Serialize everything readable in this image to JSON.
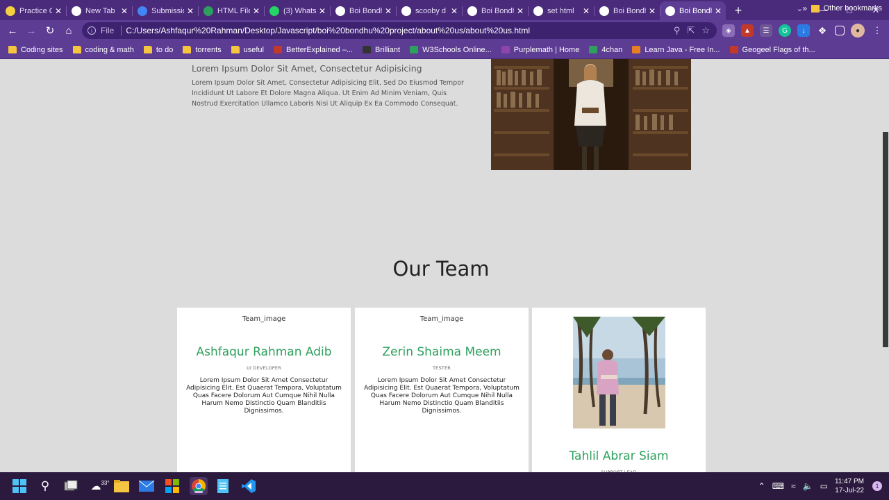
{
  "browser": {
    "tabs": [
      {
        "title": "Practice C",
        "favicon": "practice-favicon",
        "color": "#f5d142"
      },
      {
        "title": "New Tab",
        "favicon": "chrome-favicon",
        "color": "#ffffff"
      },
      {
        "title": "Submissio",
        "favicon": "chart-favicon",
        "color": "#4285f4"
      },
      {
        "title": "HTML File",
        "favicon": "w-favicon",
        "color": "#2ea05e"
      },
      {
        "title": "(3) Whats",
        "favicon": "whatsapp-favicon",
        "color": "#25d366"
      },
      {
        "title": "Boi Bondh",
        "favicon": "globe-favicon",
        "color": "#ffffff"
      },
      {
        "title": "scooby d",
        "favicon": "google-favicon",
        "color": "#ffffff"
      },
      {
        "title": "Boi Bondh",
        "favicon": "globe-favicon",
        "color": "#ffffff"
      },
      {
        "title": "set html",
        "favicon": "google-favicon",
        "color": "#ffffff"
      },
      {
        "title": "Boi Bondh",
        "favicon": "globe-favicon",
        "color": "#ffffff"
      },
      {
        "title": "Boi Bondh",
        "favicon": "globe-favicon",
        "color": "#ffffff",
        "active": true
      }
    ],
    "new_tab_symbol": "+",
    "address": {
      "scheme": "File",
      "url": "C:/Users/Ashfaqur%20Rahman/Desktop/Javascript/boi%20bondhu%20project/about%20us/about%20us.html"
    },
    "bookmarks": [
      {
        "label": "Coding sites",
        "icon": "folder-icon"
      },
      {
        "label": "coding & math",
        "icon": "folder-icon"
      },
      {
        "label": "to do",
        "icon": "folder-icon"
      },
      {
        "label": "torrents",
        "icon": "folder-icon"
      },
      {
        "label": "useful",
        "icon": "folder-icon"
      },
      {
        "label": "BetterExplained –...",
        "icon": "be-icon",
        "color": "#c0392b"
      },
      {
        "label": "Brilliant",
        "icon": "brilliant-icon",
        "color": "#333333"
      },
      {
        "label": "W3Schools Online...",
        "icon": "w3-icon",
        "color": "#2ea05e"
      },
      {
        "label": "Purplemath | Home",
        "icon": "purplemath-icon",
        "color": "#8e44ad"
      },
      {
        "label": "4chan",
        "icon": "4chan-icon",
        "color": "#2ea05e"
      },
      {
        "label": "Learn Java - Free In...",
        "icon": "java-icon",
        "color": "#e67e22"
      },
      {
        "label": "Geogeel Flags of th...",
        "icon": "geo-icon",
        "color": "#c0392b"
      }
    ],
    "bookmarks_more": "»",
    "other_bookmarks": "Other bookmarks"
  },
  "page": {
    "about_heading": "Lorem Ipsum Dolor Sit Amet, Consectetur Adipisicing",
    "about_text": "Lorem Ipsum Dolor Sit Amet, Consectetur Adipisicing Elit, Sed Do Eiusmod Tempor Incididunt Ut Labore Et Dolore Magna Aliqua. Ut Enim Ad Minim Veniam, Quis Nostrud Exercitation Ullamco Laboris Nisi Ut Aliquip Ex Ea Commodo Consequat.",
    "team_title": "Our Team",
    "team": [
      {
        "image_alt": "Team_image",
        "name": "Ashfaqur Rahman Adib",
        "role": "UI DEVELOPER",
        "desc": "Lorem Ipsum Dolor Sit Amet Consectetur Adipisicing Elit. Est Quaerat Tempora, Voluptatum Quas Facere Dolorum Aut Cumque Nihil Nulla Harum Nemo Distinctio Quam Blanditiis Dignissimos."
      },
      {
        "image_alt": "Team_image",
        "name": "Zerin Shaima Meem",
        "role": "TESTER",
        "desc": "Lorem Ipsum Dolor Sit Amet Consectetur Adipisicing Elit. Est Quaerat Tempora, Voluptatum Quas Facere Dolorum Aut Cumque Nihil Nulla Harum Nemo Distinctio Quam Blanditiis Dignissimos."
      },
      {
        "name": "Tahlil Abrar Siam",
        "role": "SUPPORT LEAD"
      }
    ],
    "accent_color": "#2ea05e"
  },
  "taskbar": {
    "weather_temp": "33°",
    "time": "11:47 PM",
    "date": "17-Jul-22",
    "notifications": "1"
  }
}
